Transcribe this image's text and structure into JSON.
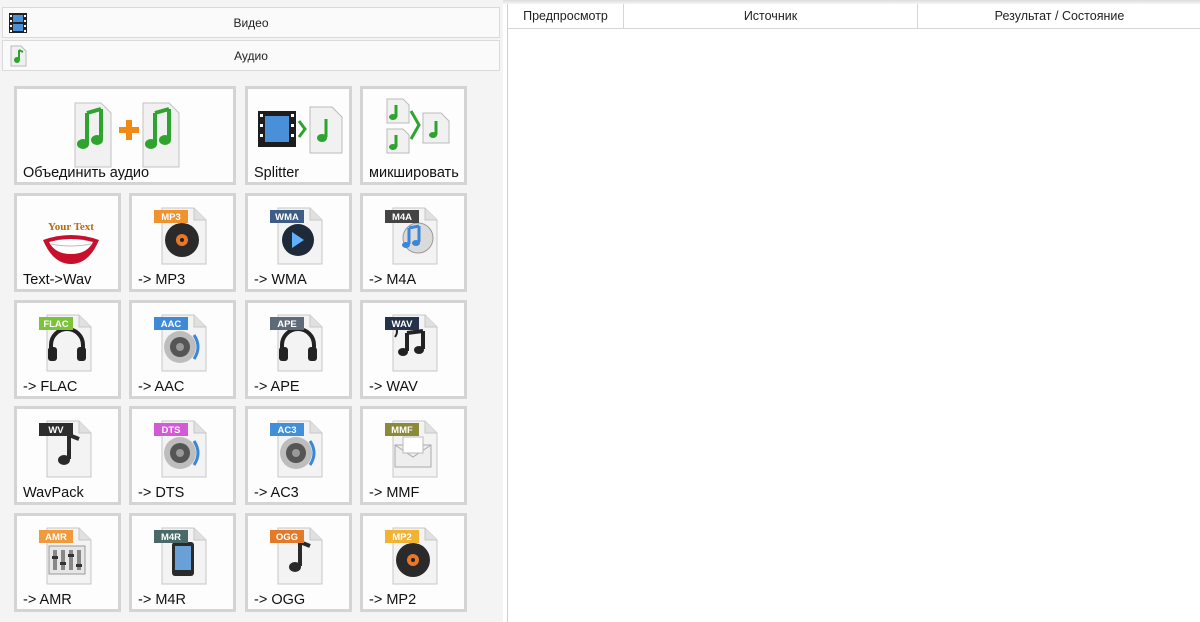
{
  "categories": {
    "video": {
      "label": "Видео",
      "icon": "film-strip-icon"
    },
    "audio": {
      "label": "Аудио",
      "icon": "music-note-icon"
    }
  },
  "tools": {
    "merge_audio": "Объединить аудио",
    "splitter": "Splitter",
    "mix": "микшировать",
    "text_to_wav": "Text->Wav",
    "text_badge": "Your Text"
  },
  "formats": [
    {
      "label": "-> MP3",
      "badge": "MP3",
      "color": "#f0922e",
      "icon": "disc-icon"
    },
    {
      "label": "-> WMA",
      "badge": "WMA",
      "color": "#3d5c86",
      "icon": "media-disc-icon"
    },
    {
      "label": "-> M4A",
      "badge": "M4A",
      "color": "#444444",
      "icon": "itunes-icon"
    },
    {
      "label": "-> FLAC",
      "badge": "FLAC",
      "color": "#7cc23b",
      "icon": "headphones-icon"
    },
    {
      "label": "-> AAC",
      "badge": "AAC",
      "color": "#3e8ad6",
      "icon": "speaker-icon"
    },
    {
      "label": "-> APE",
      "badge": "APE",
      "color": "#5f6a78",
      "icon": "headphones-icon"
    },
    {
      "label": "-> WAV",
      "badge": "WAV",
      "color": "#24324a",
      "icon": "music-notes-icon"
    },
    {
      "label": "WavPack",
      "badge": "WV",
      "color": "#2e2e2e",
      "icon": "music-note-icon"
    },
    {
      "label": "-> DTS",
      "badge": "DTS",
      "color": "#d35ad4",
      "icon": "speaker-icon"
    },
    {
      "label": "-> AC3",
      "badge": "AC3",
      "color": "#3f8fd9",
      "icon": "speaker-icon"
    },
    {
      "label": "-> MMF",
      "badge": "MMF",
      "color": "#8a8a3a",
      "icon": "envelope-icon"
    },
    {
      "label": "-> AMR",
      "badge": "AMR",
      "color": "#f09a3c",
      "icon": "mixer-icon"
    },
    {
      "label": "-> M4R",
      "badge": "M4R",
      "color": "#4a6a6a",
      "icon": "phone-icon"
    },
    {
      "label": "-> OGG",
      "badge": "OGG",
      "color": "#e27a2a",
      "icon": "music-note-icon"
    },
    {
      "label": "-> MP2",
      "badge": "MP2",
      "color": "#f2b234",
      "icon": "disc-icon"
    }
  ],
  "table": {
    "columns": [
      "Предпросмотр",
      "Источник",
      "Результат / Состояние"
    ]
  },
  "colors": {
    "note_green": "#2ea32e",
    "plus_orange": "#f08a14"
  }
}
